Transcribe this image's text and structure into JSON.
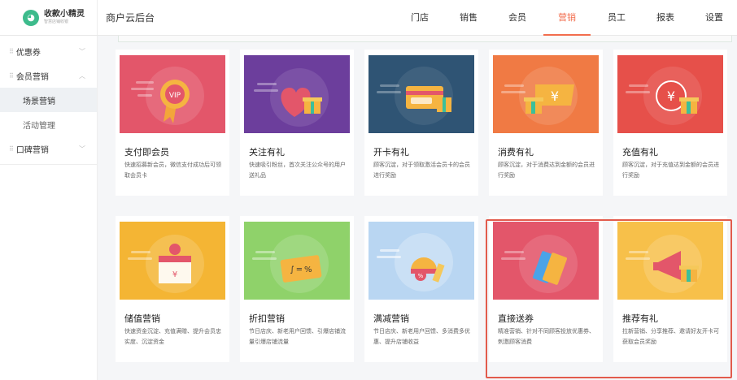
{
  "app": {
    "brand_name": "收款小精灵",
    "brand_sub": "智慧店铺收银",
    "backend_title": "商户云后台"
  },
  "nav": [
    {
      "label": "门店",
      "active": false
    },
    {
      "label": "销售",
      "active": false
    },
    {
      "label": "会员",
      "active": false
    },
    {
      "label": "营销",
      "active": true
    },
    {
      "label": "员工",
      "active": false
    },
    {
      "label": "报表",
      "active": false
    },
    {
      "label": "设置",
      "active": false
    }
  ],
  "sidebar": {
    "groups": [
      {
        "label": "优惠券",
        "expanded": false,
        "children": []
      },
      {
        "label": "会员营销",
        "expanded": true,
        "children": [
          {
            "label": "场景营销",
            "active": true
          },
          {
            "label": "活动管理",
            "active": false
          }
        ]
      },
      {
        "label": "口碑营销",
        "expanded": false,
        "children": []
      }
    ]
  },
  "cards": [
    {
      "title": "支付即会员",
      "desc": "快速招募新会员，微信支付成功后可领取会员卡",
      "bg": "#e3566a",
      "icon": "vip-badge-icon"
    },
    {
      "title": "关注有礼",
      "desc": "快速吸引粉丝，首次关注公众号的用户送礼品",
      "bg": "#6c3e9c",
      "icon": "heart-gift-icon"
    },
    {
      "title": "开卡有礼",
      "desc": "顾客沉淀，对于领取激活会员卡的会员进行奖励",
      "bg": "#2f5474",
      "icon": "member-card-icon"
    },
    {
      "title": "消费有礼",
      "desc": "顾客沉淀，对于消费达到金额的会员进行奖励",
      "bg": "#f07a44",
      "icon": "money-gift-icon"
    },
    {
      "title": "充值有礼",
      "desc": "顾客沉淀，对于充值达到金额的会员进行奖励",
      "bg": "#e6504a",
      "icon": "coin-gift-icon"
    },
    {
      "title": "储值营销",
      "desc": "快速资金沉淀、充值满赠、提升会员忠实度、沉淀资金",
      "bg": "#f4b534",
      "icon": "piggy-box-icon"
    },
    {
      "title": "折扣营销",
      "desc": "节日店庆、新老用户回馈、引爆店铺流量引爆店铺流量",
      "bg": "#8fd26a",
      "icon": "discount-card-icon"
    },
    {
      "title": "满减营销",
      "desc": "节日店庆、新老用户回馈、多消费多优惠、提升店铺收益",
      "bg": "#b9d6f2",
      "icon": "discount-tag-icon"
    },
    {
      "title": "直接送券",
      "desc": "精准营销、针对不同顾客投放优惠券、刺激顾客消费",
      "bg": "#e3566a",
      "icon": "coupon-tickets-icon"
    },
    {
      "title": "推荐有礼",
      "desc": "拉新营销、分享推荐、邀请好友开卡可获取会员奖励",
      "bg": "#f7c04a",
      "icon": "megaphone-gift-icon"
    }
  ]
}
